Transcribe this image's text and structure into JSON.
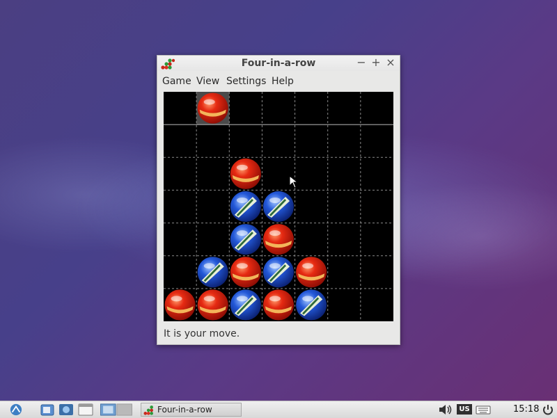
{
  "window": {
    "title": "Four-in-a-row",
    "controls": {
      "minimize": "−",
      "maximize": "+",
      "close": "×"
    }
  },
  "menu": [
    "Game",
    "View",
    "Settings",
    "Help"
  ],
  "status": "It is your move.",
  "colors": {
    "red_piece": "#d81f10",
    "blue_piece": "#1e4fd0",
    "board": "#000000"
  },
  "board": {
    "columns": 7,
    "rows": 7,
    "highlight_column": 1,
    "pieces": [
      {
        "col": 1,
        "row": 0,
        "color": "red"
      },
      {
        "col": 2,
        "row": 2,
        "color": "red"
      },
      {
        "col": 2,
        "row": 3,
        "color": "blue"
      },
      {
        "col": 3,
        "row": 3,
        "color": "blue"
      },
      {
        "col": 2,
        "row": 4,
        "color": "blue"
      },
      {
        "col": 3,
        "row": 4,
        "color": "red"
      },
      {
        "col": 1,
        "row": 5,
        "color": "blue"
      },
      {
        "col": 2,
        "row": 5,
        "color": "red"
      },
      {
        "col": 3,
        "row": 5,
        "color": "blue"
      },
      {
        "col": 4,
        "row": 5,
        "color": "red"
      },
      {
        "col": 0,
        "row": 6,
        "color": "red"
      },
      {
        "col": 1,
        "row": 6,
        "color": "red"
      },
      {
        "col": 2,
        "row": 6,
        "color": "blue"
      },
      {
        "col": 3,
        "row": 6,
        "color": "red"
      },
      {
        "col": 4,
        "row": 6,
        "color": "blue"
      }
    ]
  },
  "taskbar": {
    "task_label": "Four-in-a-row",
    "layout_indicator": "US",
    "clock": "15:18"
  }
}
